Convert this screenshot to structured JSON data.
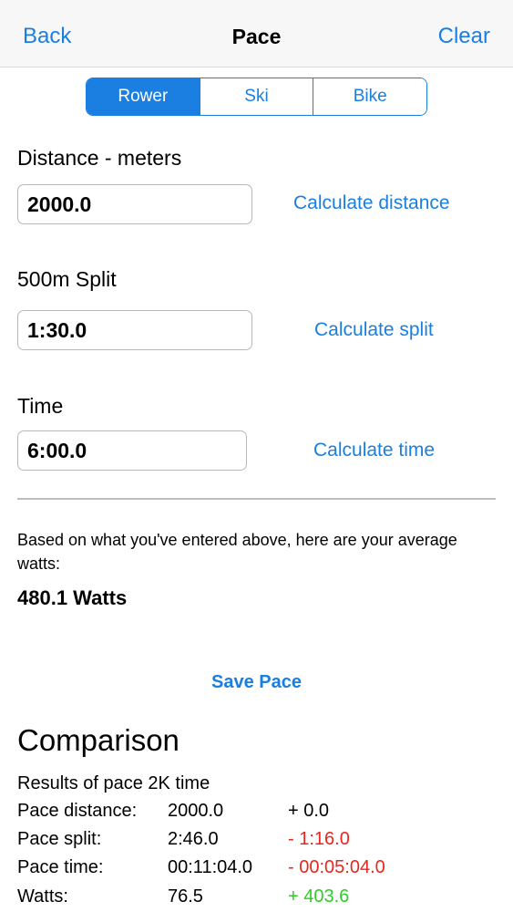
{
  "navbar": {
    "back_label": "Back",
    "title": "Pace",
    "clear_label": "Clear"
  },
  "sport_selector": {
    "options": [
      "Rower",
      "Ski",
      "Bike"
    ],
    "selected": "Rower"
  },
  "distance": {
    "label": "Distance - meters",
    "value": "2000.0",
    "calculate_label": "Calculate distance"
  },
  "split": {
    "label": "500m Split",
    "value": "1:30.0",
    "calculate_label": "Calculate split"
  },
  "time": {
    "label": "Time",
    "value": "6:00.0",
    "calculate_label": "Calculate time"
  },
  "watts": {
    "info_text": "Based on what you've entered above, here are your average watts:",
    "value": "480.1 Watts"
  },
  "save_label": "Save Pace",
  "comparison": {
    "title": "Comparison",
    "subtitle": "Results of pace 2K time",
    "rows": [
      {
        "label": "Pace distance:",
        "value": "2000.0",
        "diff": "+ 0.0"
      },
      {
        "label": "Pace split:",
        "value": "2:46.0",
        "diff": "- 1:16.0"
      },
      {
        "label": "Pace time:",
        "value": "00:11:04.0",
        "diff": "- 00:05:04.0"
      },
      {
        "label": "Watts:",
        "value": "76.5",
        "diff": "+ 403.6"
      }
    ]
  },
  "colors": {
    "accent": "#1a7fe0",
    "negative": "#e8261f",
    "positive": "#2ecc28"
  }
}
